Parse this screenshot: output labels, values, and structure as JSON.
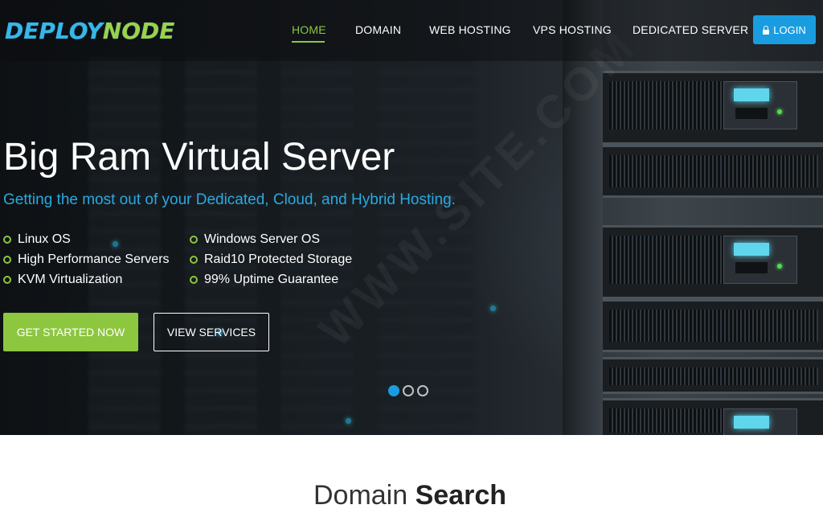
{
  "brand": {
    "logo_part1": "DEPLOY",
    "logo_part2": "NODE"
  },
  "nav": {
    "items": [
      {
        "label": "HOME",
        "active": true
      },
      {
        "label": "DOMAIN"
      },
      {
        "label": "WEB HOSTING"
      },
      {
        "label": "VPS HOSTING"
      },
      {
        "label": "DEDICATED SERVER"
      }
    ],
    "login_label": "LOGIN"
  },
  "hero": {
    "title": "Big Ram Virtual Server",
    "subtitle": "Getting the most out of your Dedicated, Cloud, and Hybrid Hosting.",
    "features_left": [
      "Linux OS",
      "High Performance Servers",
      "KVM Virtualization"
    ],
    "features_right": [
      "Windows Server OS",
      "Raid10 Protected Storage",
      "99% Uptime Guarantee"
    ],
    "primary_button": "GET STARTED NOW",
    "secondary_button": "VIEW SERVICES",
    "slides": {
      "count": 3,
      "active": 1
    }
  },
  "domain_section": {
    "title_light": "Domain ",
    "title_bold": "Search"
  },
  "colors": {
    "accent_green": "#8dc63f",
    "accent_blue": "#1a9ce0"
  }
}
